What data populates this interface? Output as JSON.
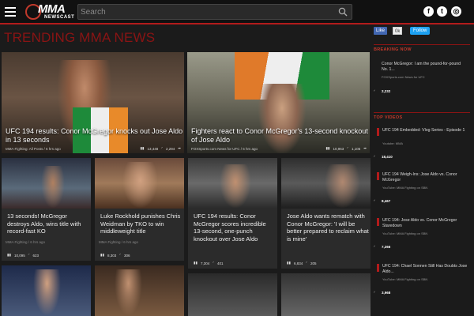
{
  "header": {
    "logo_big": "MMA",
    "logo_small": "NEWSCAST",
    "search_placeholder": "Search",
    "social": {
      "facebook": "f",
      "twitter": "t",
      "instagram": "◎"
    }
  },
  "page": {
    "heading": "TRENDING MMA NEWS",
    "fb_like": "Like",
    "fb_count": "0k",
    "twitter_follow": "Follow"
  },
  "featured": [
    {
      "title": "UFC 194 results: Conor McGregor knocks out Jose Aldo in 13 seconds",
      "source": "MMA Fighting: All Posts / 6 hrs ago",
      "views": "13,448",
      "signal": "2,294",
      "bg": "#5b4a3c"
    },
    {
      "title": "Fighters react to Conor McGregor's 13-second knockout of Jose Aldo",
      "source": "FOXSports.com News for UFC / 5 hrs ago",
      "views": "10,963",
      "signal": "1,105",
      "bg": "#6b6a5c"
    }
  ],
  "grid": [
    {
      "title": "13 seconds! McGregor destroys Aldo, wins title with record-fast KO",
      "source": "MMA Fighting / 6 hrs ago",
      "views": "10,095",
      "signal": "623",
      "bg": "#31384a"
    },
    {
      "title": "Luke Rockhold punishes Chris Weidman by TKO to win middleweight title",
      "source": "MMA Fighting / 6 hrs ago",
      "views": "8,303",
      "signal": "306",
      "bg": "#7b5a4a"
    },
    {
      "title": "UFC 194 results: Conor McGregor scores incredible 13-second, one-punch knockout over Jose Aldo",
      "source": "MMA Fighting / 6 hrs ago",
      "views": "7,304",
      "signal": "401",
      "bg": "#4c4c4c"
    },
    {
      "title": "Jose Aldo wants rematch with Conor McGregor: 'I will be better prepared to reclaim what is mine'",
      "source": "MMA Fighting / 5 hrs ago",
      "views": "6,834",
      "signal": "205",
      "bg": "#3e3e3e"
    }
  ],
  "bottom_row": [
    {
      "bg": "#28304a"
    },
    {
      "bg": "#4a3a30"
    },
    {
      "bg": "#3a3a3a"
    },
    {
      "bg": "#444444"
    }
  ],
  "sidebar": {
    "breaking_head": "BREAKING NOW",
    "breaking": [
      {
        "title": "Conor McGregor: I am the pound-for-pound No. 1...",
        "source": "FOXSports.com News for UFC",
        "count": "2,232"
      }
    ],
    "videos_head": "TOP VIDEOS",
    "videos": [
      {
        "title": "UFC 194 Embedded: Vlog Series - Episode 1",
        "source": "Youtube: MMA",
        "count": "18,410"
      },
      {
        "title": "UFC 194 Weigh-Ins: Jose Aldo vs. Conor McGregor",
        "source": "YouTube: MMA Fighting on SBN",
        "count": "8,467"
      },
      {
        "title": "UFC 194: Jose Aldo vs. Conor McGregor Staredown",
        "source": "YouTube: MMA Fighting on SBN",
        "count": "7,266"
      },
      {
        "title": "UFC 194: Chael Sonnen Still Has Doubts Jose Aldo...",
        "source": "YouTube: MMA Fighting on SBN",
        "count": "3,968"
      }
    ]
  },
  "colors": {
    "accent": "#b31b1b",
    "heading": "#8a1414"
  }
}
